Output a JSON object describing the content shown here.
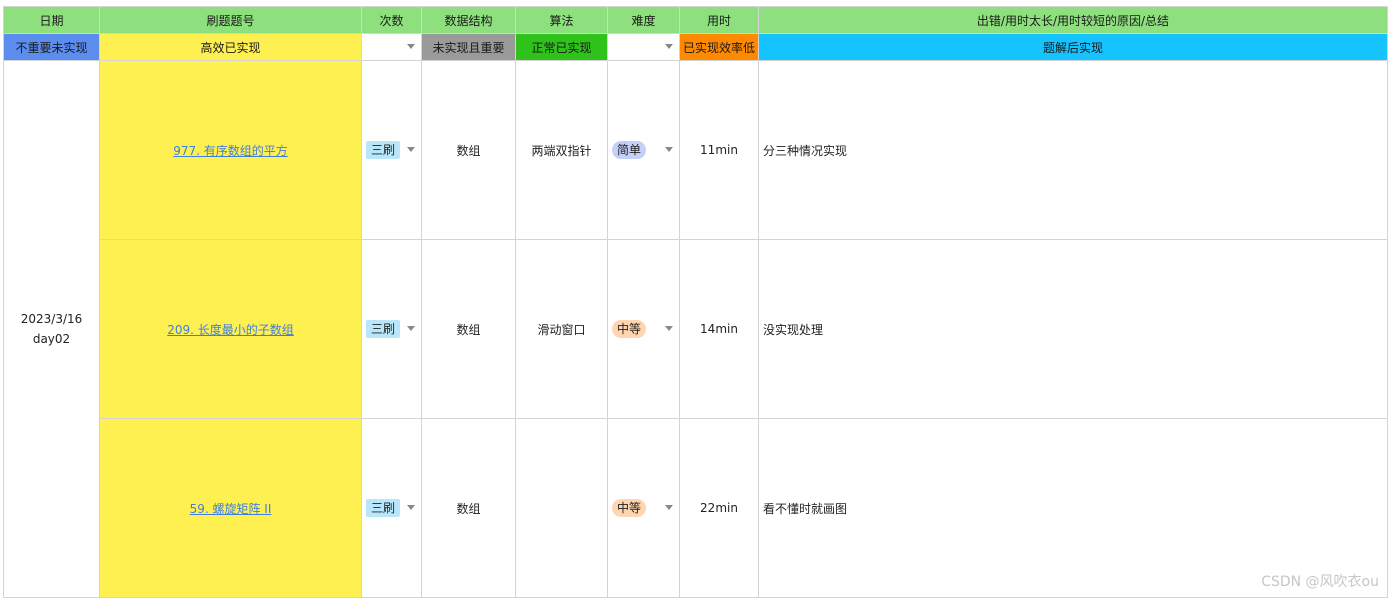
{
  "headers": {
    "date": "日期",
    "title": "刷题题号",
    "times": "次数",
    "data_structure": "数据结构",
    "algorithm": "算法",
    "difficulty": "难度",
    "time_used": "用时",
    "notes": "出错/用时太长/用时较短的原因/总结"
  },
  "legend": {
    "not_important": "不重要未实现",
    "efficient": "高效已实现",
    "important_unimplemented": "未实现且重要",
    "normal": "正常已实现",
    "inefficient": "已实现效率低",
    "after_solution": "题解后实现"
  },
  "date_cell": {
    "date": "2023/3/16",
    "day": "day02"
  },
  "rows": [
    {
      "title": "977. 有序数组的平方",
      "times": "三刷",
      "data_structure": "数组",
      "algorithm": "两端双指针",
      "difficulty": "简单",
      "time_used": "11min",
      "notes": "分三种情况实现"
    },
    {
      "title": "209. 长度最小的子数组",
      "times": "三刷",
      "data_structure": "数组",
      "algorithm": "滑动窗口",
      "difficulty": "中等",
      "time_used": "14min",
      "notes": "没实现处理"
    },
    {
      "title": "59. 螺旋矩阵 II",
      "times": "三刷",
      "data_structure": "数组",
      "algorithm": "",
      "difficulty": "中等",
      "time_used": "22min",
      "notes": "看不懂时就画图"
    }
  ],
  "colors": {
    "header_green": "#8ee07e",
    "legend_blue": "#5b8def",
    "legend_yellow": "#fff052",
    "legend_gray": "#9a9a9a",
    "legend_green": "#2ec21b",
    "legend_orange": "#ff8a00",
    "legend_cyan": "#15c3ff",
    "link_blue": "#3f7fe0"
  },
  "icons": {
    "dropdown": "chevron-down-icon"
  },
  "watermark": "CSDN @风吹衣ou"
}
